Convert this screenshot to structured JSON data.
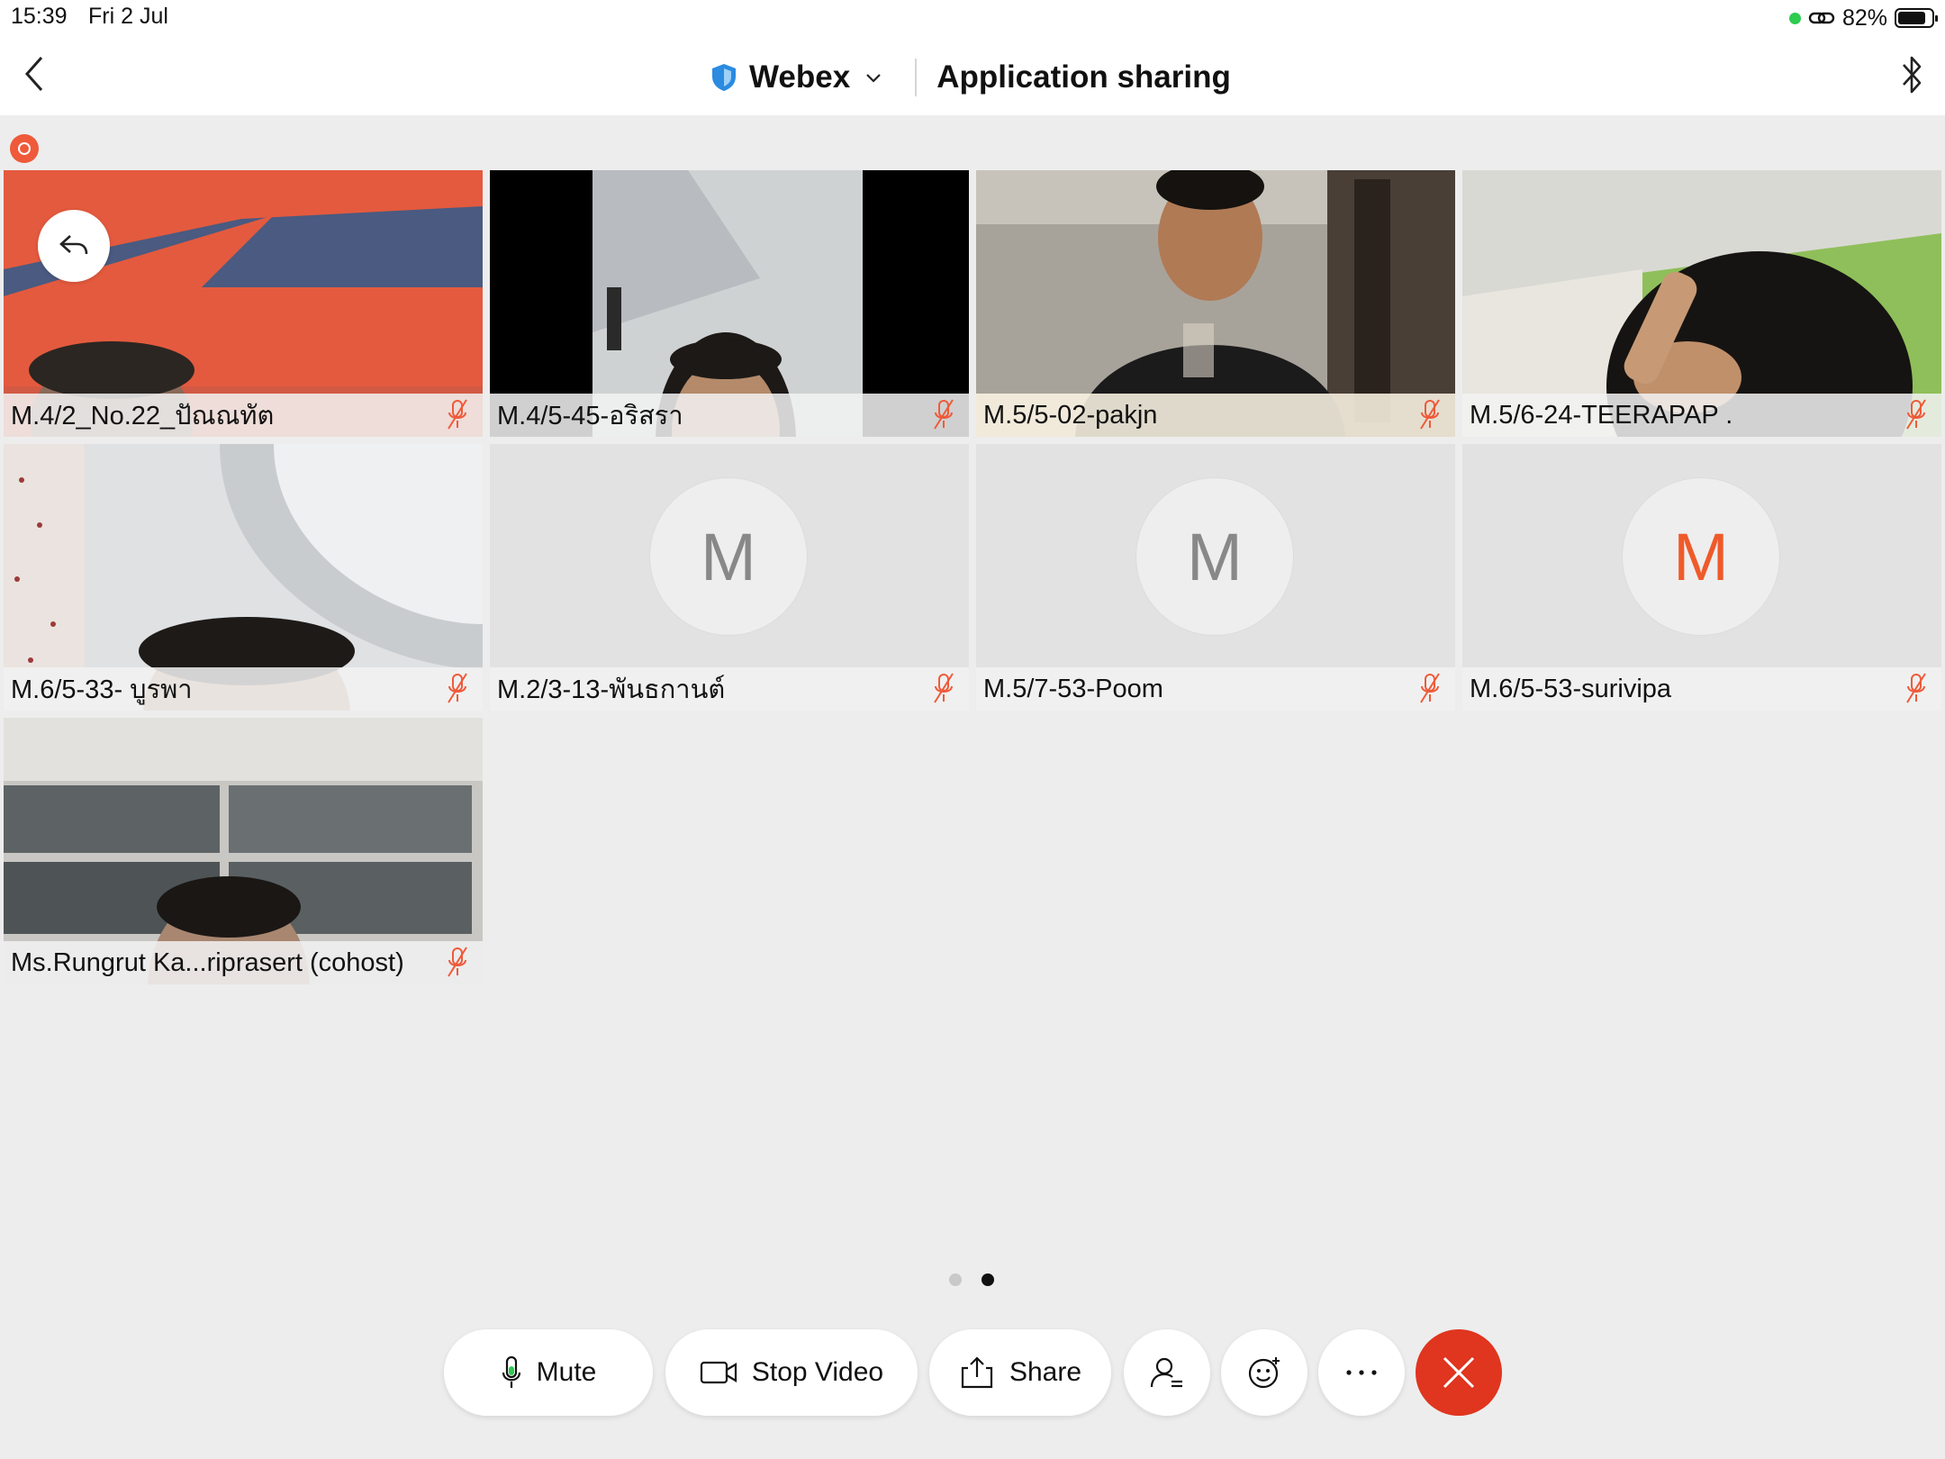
{
  "status": {
    "time": "15:39",
    "date": "Fri 2 Jul",
    "battery": "82%",
    "battery_level": 0.82
  },
  "nav": {
    "app_name": "Webex",
    "title": "Application sharing"
  },
  "participants": [
    {
      "name": "M.4/2_No.22_ปัณณทัต",
      "video": true
    },
    {
      "name": "M.4/5-45-อริสรา",
      "video": true
    },
    {
      "name": "M.5/5-02-pakjn",
      "video": true
    },
    {
      "name": "M.5/6-24-TEERAPAP .",
      "video": true
    },
    {
      "name": "M.6/5-33- บูรพา",
      "video": true
    },
    {
      "name": "M.2/3-13-พันธกานต์",
      "video": false,
      "initial": "M"
    },
    {
      "name": "M.5/7-53-Poom",
      "video": false,
      "initial": "M"
    },
    {
      "name": "M.6/5-53-surivipa",
      "video": false,
      "initial": "M"
    },
    {
      "name": "Ms.Rungrut Ka...riprasert (cohost)",
      "video": true
    }
  ],
  "pager": {
    "pages": 2,
    "current": 2
  },
  "controls": {
    "mute": "Mute",
    "stop_video": "Stop Video",
    "share": "Share"
  },
  "colors": {
    "accent": "#ef5a2a",
    "end_call": "#e0351f",
    "mute_icon": "#ef5a3a"
  }
}
